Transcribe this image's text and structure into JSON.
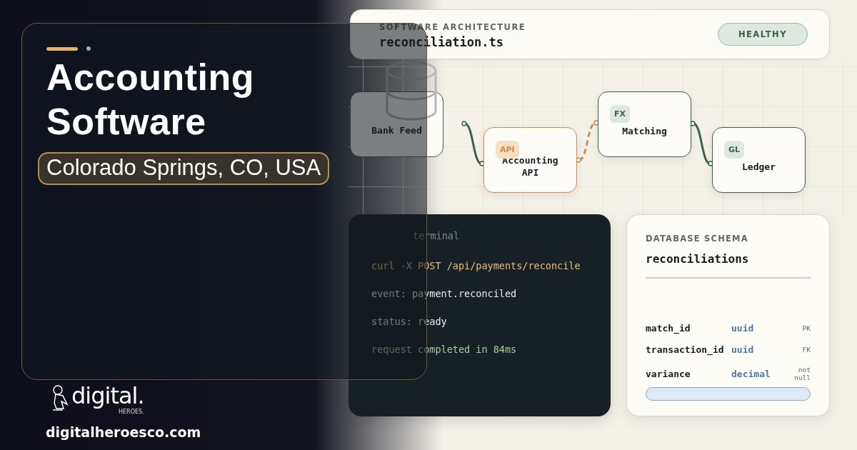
{
  "intro": {
    "title": "Accounting Software",
    "location": "Colorado Springs, CO, USA"
  },
  "brand": {
    "logo_word": "digital.",
    "logo_sub": "HEROES.",
    "url": "digitalheroesco.com"
  },
  "architecture": {
    "eyebrow": "SOFTWARE ARCHITECTURE",
    "file": "reconciliation.ts",
    "status": "HEALTHY",
    "nodes": [
      {
        "label": "Bank Feed",
        "kind": "source"
      },
      {
        "label": "Accounting API",
        "badge": "API",
        "kind": "api"
      },
      {
        "label": "Matching",
        "badge": "FX",
        "kind": "service"
      },
      {
        "label": "Ledger",
        "badge": "GL",
        "kind": "service"
      }
    ]
  },
  "terminal": {
    "title": "terminal",
    "lines": [
      {
        "text": "curl -X POST /api/payments/reconcile",
        "kind": "command"
      },
      {
        "text": "event: payment.reconciled",
        "kind": "output"
      },
      {
        "text": "status: ready",
        "kind": "output"
      },
      {
        "text": "request completed in 84ms",
        "kind": "success"
      }
    ]
  },
  "schema": {
    "eyebrow": "DATABASE SCHEMA",
    "table": "reconciliations",
    "fields": [
      {
        "name": "match_id",
        "type": "uuid",
        "constraint": "PK"
      },
      {
        "name": "transaction_id",
        "type": "uuid",
        "constraint": "FK"
      },
      {
        "name": "variance",
        "type": "decimal",
        "constraint": "not null"
      }
    ]
  }
}
